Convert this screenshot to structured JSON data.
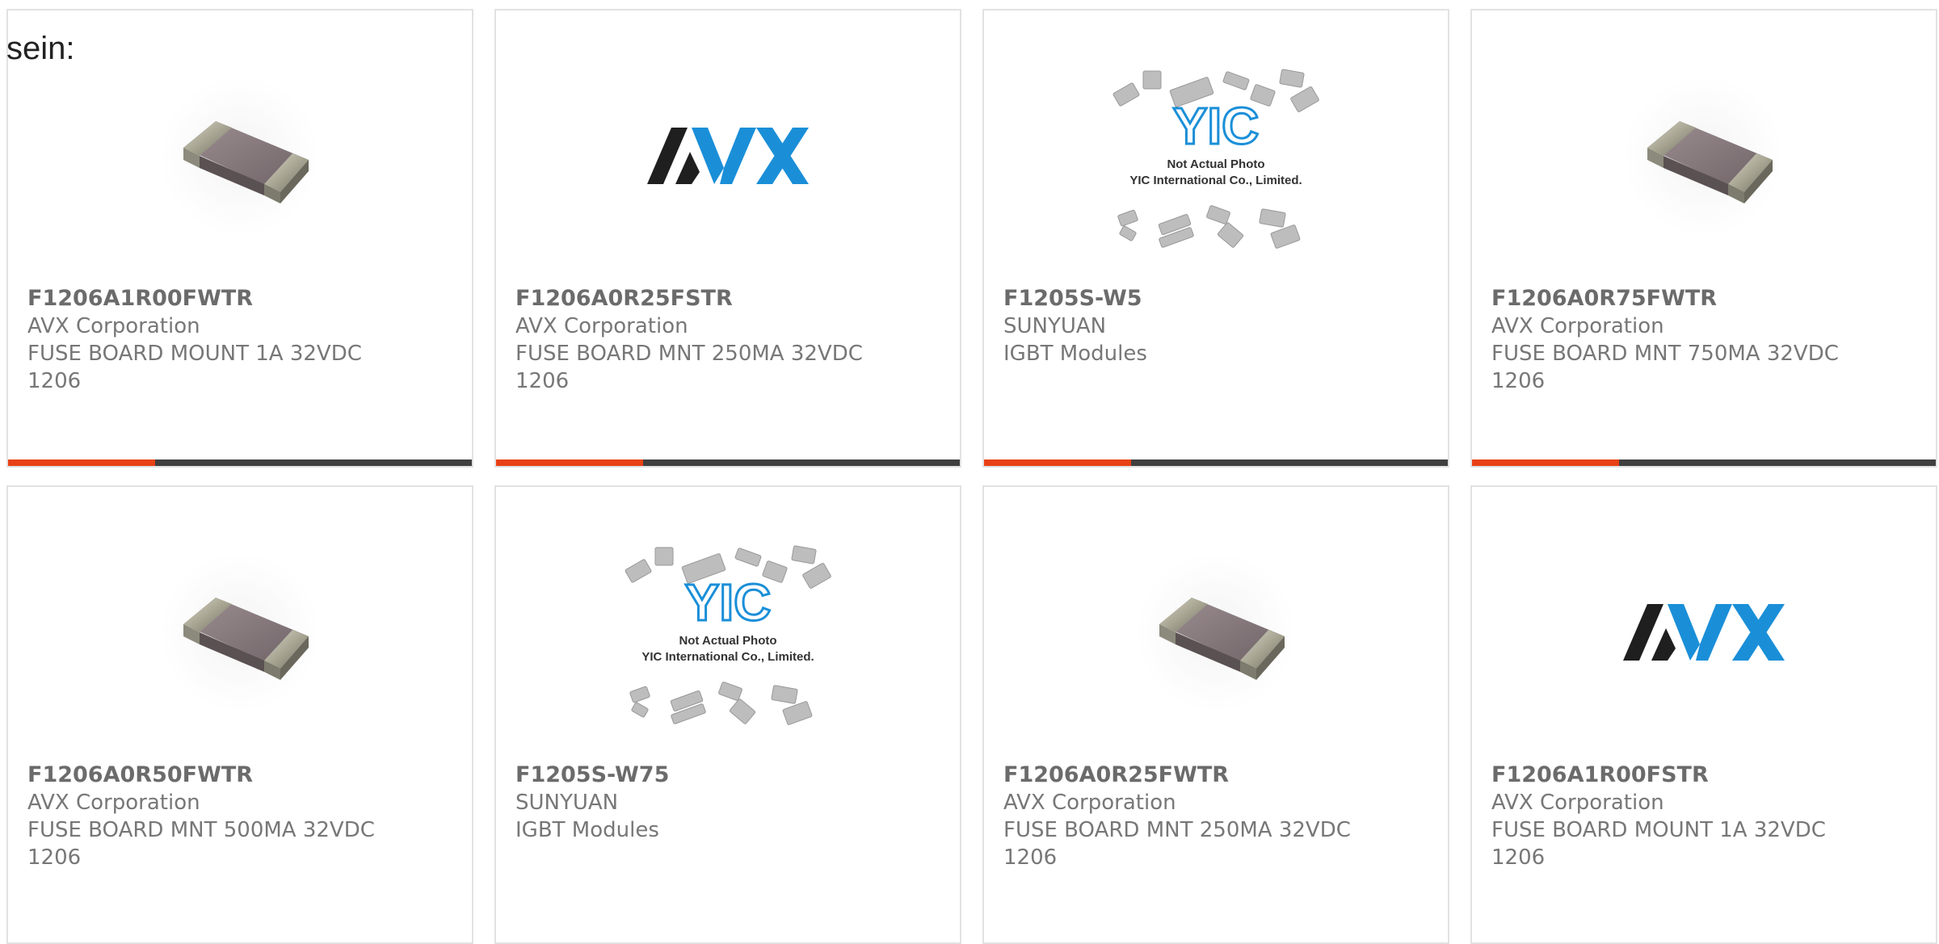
{
  "intro_text": "sein:",
  "products": [
    {
      "part": "F1206A1R00FWTR",
      "maker": "AVX Corporation",
      "desc": "FUSE BOARD MOUNT 1A 32VDC",
      "pkg": "1206",
      "image": "chip-fuse"
    },
    {
      "part": "F1206A0R25FSTR",
      "maker": "AVX Corporation",
      "desc": "FUSE BOARD MNT 250MA 32VDC",
      "pkg": "1206",
      "image": "avx-logo"
    },
    {
      "part": "F1205S-W5",
      "maker": "SUNYUAN",
      "desc": "IGBT Modules",
      "pkg": "",
      "image": "yic-placeholder"
    },
    {
      "part": "F1206A0R75FWTR",
      "maker": "AVX Corporation",
      "desc": "FUSE BOARD MNT 750MA 32VDC",
      "pkg": "1206",
      "image": "chip-fuse"
    },
    {
      "part": "F1206A0R50FWTR",
      "maker": "AVX Corporation",
      "desc": "FUSE BOARD MNT 500MA 32VDC",
      "pkg": "1206",
      "image": "chip-fuse"
    },
    {
      "part": "F1205S-W75",
      "maker": "SUNYUAN",
      "desc": "IGBT Modules",
      "pkg": "",
      "image": "yic-placeholder"
    },
    {
      "part": "F1206A0R25FWTR",
      "maker": "AVX Corporation",
      "desc": "FUSE BOARD MNT 250MA 32VDC",
      "pkg": "1206",
      "image": "chip-fuse"
    },
    {
      "part": "F1206A1R00FSTR",
      "maker": "AVX Corporation",
      "desc": "FUSE BOARD MOUNT 1A 32VDC",
      "pkg": "1206",
      "image": "avx-logo"
    }
  ],
  "yic_placeholder": {
    "line1": "Not Actual Photo",
    "line2": "YIC International Co., Limited."
  },
  "avx_logo_text": "AVX",
  "colors": {
    "accent": "#e84116",
    "bar": "#404040",
    "avx_blue": "#1a8fd8",
    "text": "#777777"
  }
}
